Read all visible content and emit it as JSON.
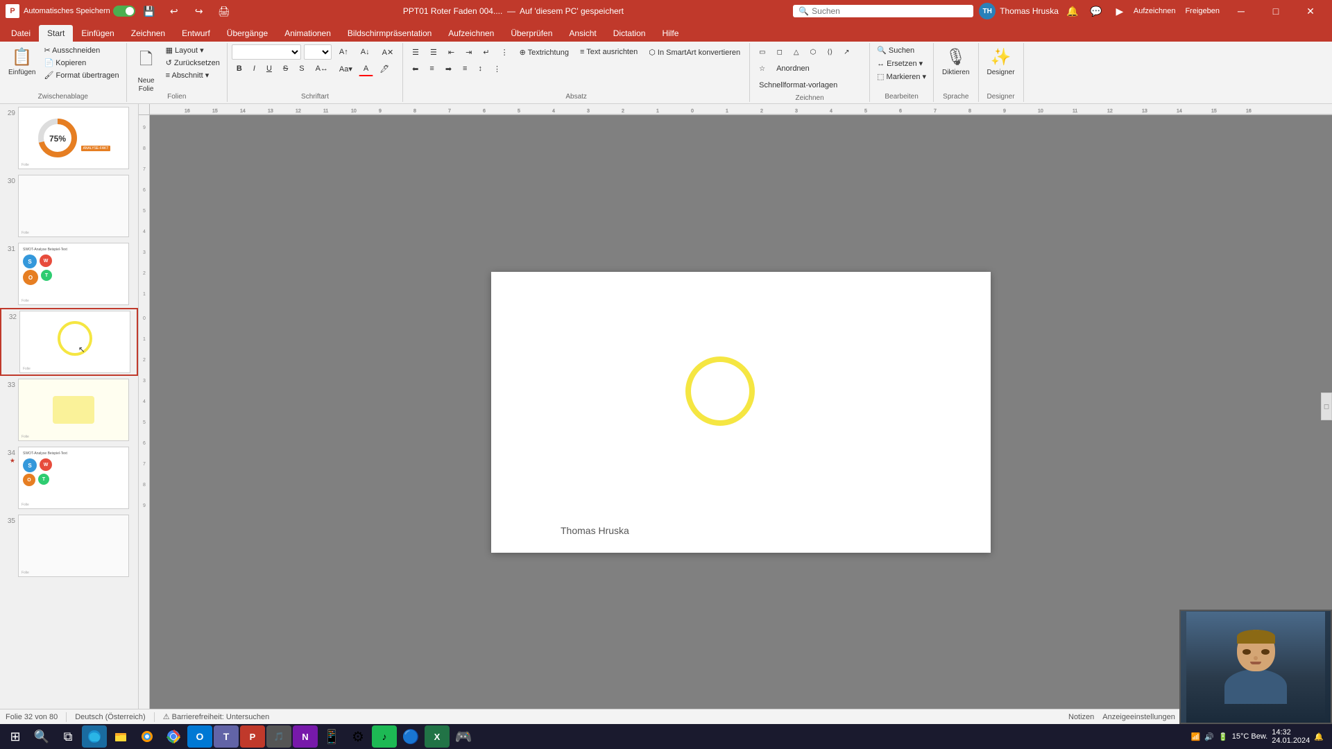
{
  "titleBar": {
    "appName": "PPT01 Roter Faden 004....",
    "saveStatus": "Auf 'diesem PC' gespeichert",
    "autosave": "Automatisches Speichern",
    "user": "Thomas Hruska",
    "userInitials": "TH",
    "searchPlaceholder": "Suchen"
  },
  "ribbonTabs": [
    {
      "id": "datei",
      "label": "Datei"
    },
    {
      "id": "start",
      "label": "Start",
      "active": true
    },
    {
      "id": "einfuegen",
      "label": "Einfügen"
    },
    {
      "id": "zeichnen",
      "label": "Zeichnen"
    },
    {
      "id": "entwurf",
      "label": "Entwurf"
    },
    {
      "id": "uebergaenge",
      "label": "Übergänge"
    },
    {
      "id": "animationen",
      "label": "Animationen"
    },
    {
      "id": "bildschirmpraesenation",
      "label": "Bildschirmpräsentation"
    },
    {
      "id": "aufzeichnen",
      "label": "Aufzeichnen"
    },
    {
      "id": "ueberpruefen",
      "label": "Überprüfen"
    },
    {
      "id": "ansicht",
      "label": "Ansicht"
    },
    {
      "id": "dictation",
      "label": "Dictation"
    },
    {
      "id": "hilfe",
      "label": "Hilfe"
    }
  ],
  "ribbonGroups": {
    "zwischenablage": {
      "label": "Zwischenablage",
      "buttons": [
        "Einfügen",
        "Ausschneiden",
        "Kopieren",
        "Format übertragen"
      ]
    },
    "folien": {
      "label": "Folien",
      "buttons": [
        "Neue Folie",
        "Layout",
        "Zurücksetzen",
        "Abschnitt"
      ]
    },
    "schriftart": {
      "label": "Schriftart"
    },
    "absatz": {
      "label": "Absatz"
    },
    "zeichnen_group": {
      "label": "Zeichnen"
    },
    "bearbeiten": {
      "label": "Bearbeiten",
      "buttons": [
        "Suchen",
        "Ersetzen",
        "Markieren"
      ]
    },
    "sprache": {
      "label": "Sprache",
      "buttons": [
        "Diktieren"
      ]
    },
    "designer": {
      "label": "Designer",
      "buttons": [
        "Designer"
      ]
    }
  },
  "slides": [
    {
      "number": 29,
      "type": "donut"
    },
    {
      "number": 30,
      "type": "blank"
    },
    {
      "number": 31,
      "type": "swot"
    },
    {
      "number": 32,
      "type": "circle",
      "active": true
    },
    {
      "number": 33,
      "type": "yellow"
    },
    {
      "number": 34,
      "type": "swot2"
    },
    {
      "number": 35,
      "type": "blank2"
    }
  ],
  "currentSlide": {
    "number": 32,
    "total": 80,
    "authorText": "Thomas Hruska"
  },
  "statusBar": {
    "slideInfo": "Folie 32 von 80",
    "language": "Deutsch (Österreich)",
    "accessibility": "Barrierefreiheit: Untersuchen",
    "notes": "Notizen",
    "slideshow": "Anzeigeeinstellungen"
  },
  "taskbarApps": [
    {
      "name": "windows-start",
      "icon": "⊞"
    },
    {
      "name": "search",
      "icon": "🔍"
    },
    {
      "name": "task-view",
      "icon": "⧉"
    },
    {
      "name": "edge",
      "icon": "🌐"
    },
    {
      "name": "explorer",
      "icon": "📁"
    },
    {
      "name": "firefox",
      "icon": "🦊"
    },
    {
      "name": "chrome",
      "icon": "⬤"
    },
    {
      "name": "outlook",
      "icon": "📧"
    },
    {
      "name": "teams",
      "icon": "T"
    },
    {
      "name": "powerpoint",
      "icon": "P"
    },
    {
      "name": "onenote",
      "icon": "N"
    },
    {
      "name": "excel",
      "icon": "X"
    }
  ],
  "taskbarRight": {
    "temperature": "15°C",
    "weather": "Bew."
  },
  "colors": {
    "accent": "#c0392b",
    "yellow": "#f5e642",
    "swotS": "#3498db",
    "swotW": "#e74c3c",
    "swotO": "#e67e22",
    "swotT": "#2ecc71"
  }
}
